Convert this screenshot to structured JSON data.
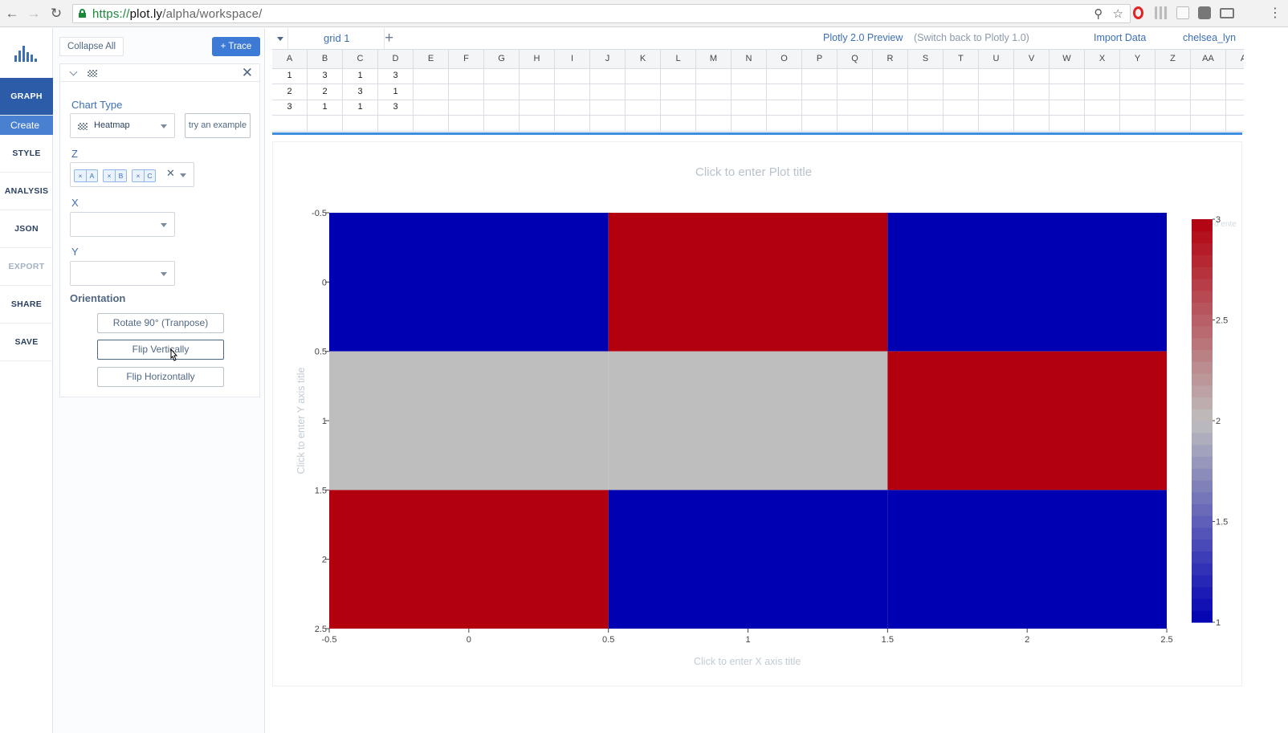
{
  "browser": {
    "url_scheme": "https://",
    "url_host": "plot.ly",
    "url_path": "/alpha/workspace/"
  },
  "leftnav": {
    "items": [
      {
        "label": "GRAPH",
        "active": true
      },
      {
        "label": "STYLE"
      },
      {
        "label": "ANALYSIS"
      },
      {
        "label": "JSON"
      },
      {
        "label": "EXPORT",
        "dim": true
      },
      {
        "label": "SHARE"
      },
      {
        "label": "SAVE"
      }
    ],
    "sub_active": "Create"
  },
  "panel": {
    "collapse_all": "Collapse All",
    "add_trace": "+ Trace",
    "chart_type_label": "Chart Type",
    "chart_type_value": "Heatmap",
    "try_example": "try an example",
    "z_label": "Z",
    "z_chips": [
      "A",
      "B",
      "C"
    ],
    "x_label": "X",
    "y_label": "Y",
    "orientation_label": "Orientation",
    "rotate_btn": "Rotate 90° (Tranpose)",
    "flip_v_btn": "Flip Vertically",
    "flip_h_btn": "Flip Horizontally"
  },
  "grid": {
    "tab_label": "grid 1",
    "preview_label": "Plotly 2.0 Preview",
    "switch_back": "(Switch back to Plotly 1.0)",
    "import_data": "Import Data",
    "username": "chelsea_lyn",
    "columns": [
      "A",
      "B",
      "C",
      "D",
      "E",
      "F",
      "G",
      "H",
      "I",
      "J",
      "K",
      "L",
      "M",
      "N",
      "O",
      "P",
      "Q",
      "R",
      "S",
      "T",
      "U",
      "V",
      "W",
      "X",
      "Y",
      "Z",
      "AA",
      "A"
    ],
    "rows": [
      [
        "1",
        "3",
        "1",
        "3"
      ],
      [
        "2",
        "2",
        "3",
        "1"
      ],
      [
        "3",
        "1",
        "1",
        "3"
      ]
    ]
  },
  "plot": {
    "title_placeholder": "Click to enter Plot title",
    "x_title_placeholder": "Click to enter X axis title",
    "y_title_placeholder": "Click to enter Y axis title",
    "colorbar_title_placeholder": "o ente"
  },
  "chart_data": {
    "type": "heatmap",
    "x_ticks": [
      "-0.5",
      "0",
      "0.5",
      "1",
      "1.5",
      "2",
      "2.5"
    ],
    "y_ticks": [
      "-0.5",
      "0",
      "0.5",
      "1",
      "1.5",
      "2",
      "2.5"
    ],
    "xlim": [
      -0.5,
      2.5
    ],
    "ylim": [
      2.5,
      -0.5
    ],
    "z": [
      [
        1,
        3,
        1
      ],
      [
        2,
        2,
        3
      ],
      [
        3,
        1,
        1
      ]
    ],
    "zlim": [
      1,
      3
    ],
    "colorbar_ticks": [
      "1",
      "1.5",
      "2",
      "2.5",
      "3"
    ],
    "colorscale": [
      "#0000b3",
      "#bebebe",
      "#b3000f"
    ]
  }
}
